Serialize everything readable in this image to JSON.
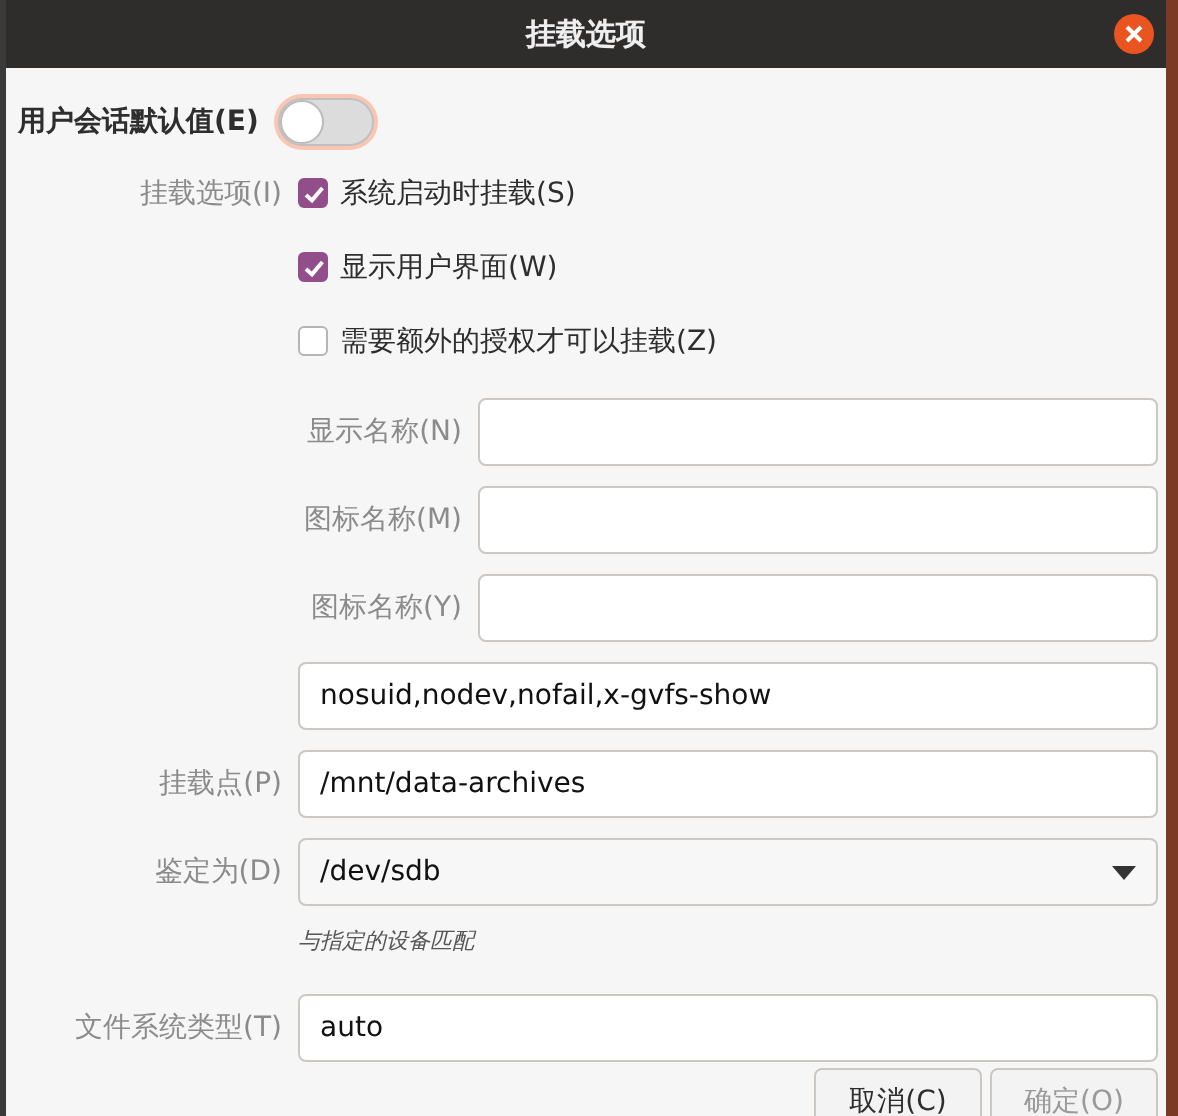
{
  "window": {
    "title": "挂载选项"
  },
  "user_defaults": {
    "label": "用户会话默认值(E)",
    "on": false
  },
  "mount_options": {
    "label": "挂载选项(I)",
    "checkboxes": [
      {
        "label": "系统启动时挂载(S)",
        "checked": true
      },
      {
        "label": "显示用户界面(W)",
        "checked": true
      },
      {
        "label": "需要额外的授权才可以挂载(Z)",
        "checked": false
      }
    ]
  },
  "name_fields": [
    {
      "label": "显示名称(N)"
    },
    {
      "label": "图标名称(M)"
    },
    {
      "label": "图标名称(Y)"
    }
  ],
  "fields": [
    {
      "kind": "entry",
      "value": "nosuid,nodev,nofail,x-gvfs-show"
    },
    {
      "kind": "entry",
      "label": "挂载点(P)",
      "value": "/mnt/data-archives"
    },
    {
      "kind": "dropdown",
      "label": "鉴定为(D)",
      "value": "/dev/sdb",
      "hint": "与指定的设备匹配"
    },
    {
      "kind": "entry",
      "label": "文件系统类型(T)",
      "value": "auto"
    }
  ],
  "buttons": [
    {
      "label": "取消(C)",
      "disabled": false
    },
    {
      "label": "确定(O)",
      "disabled": true
    }
  ]
}
